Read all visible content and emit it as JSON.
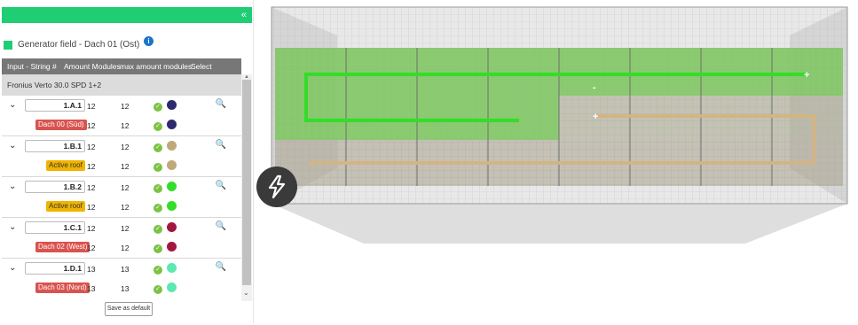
{
  "panel": {
    "collapse_icon": "«",
    "title": "Generator field - Dach 01 (Ost)",
    "info_icon": "i",
    "headers": [
      "Input - String #",
      "Amount Modules",
      "max amount modules",
      "Select"
    ],
    "inverter": "Fronius Verto 30.0 SPD 1+2",
    "strings": [
      {
        "id": "1.A.1",
        "modules": "12",
        "max_modules": "12",
        "roof": "Dach 00 (Süd)",
        "roof_style": "red",
        "color": "#2e2a6e",
        "roof_modules": "12",
        "roof_max": "12",
        "roof_color": "#2e2a6e"
      },
      {
        "id": "1.B.1",
        "modules": "12",
        "max_modules": "12",
        "roof": "Active roof",
        "roof_style": "yellow",
        "color": "#c0a878",
        "roof_modules": "12",
        "roof_max": "12",
        "roof_color": "#c0a878"
      },
      {
        "id": "1.B.2",
        "modules": "12",
        "max_modules": "12",
        "roof": "Active roof",
        "roof_style": "yellow",
        "color": "#33dd2a",
        "roof_modules": "12",
        "roof_max": "12",
        "roof_color": "#33dd2a"
      },
      {
        "id": "1.C.1",
        "modules": "12",
        "max_modules": "12",
        "roof": "Dach 02 (West)",
        "roof_style": "red",
        "color": "#a01840",
        "roof_modules": "12",
        "roof_max": "12",
        "roof_color": "#a01840"
      },
      {
        "id": "1.D.1",
        "modules": "13",
        "max_modules": "13",
        "roof": "Dach 03 (Nord)",
        "roof_style": "red",
        "color": "#5ce8b0",
        "roof_modules": "13",
        "roof_max": "13",
        "roof_color": "#5ce8b0"
      }
    ],
    "save_default_label": "Save as default"
  },
  "canvas": {
    "plus_mark": "+",
    "minus_mark": "-",
    "bolt_icon": "lightning-bolt-icon"
  }
}
